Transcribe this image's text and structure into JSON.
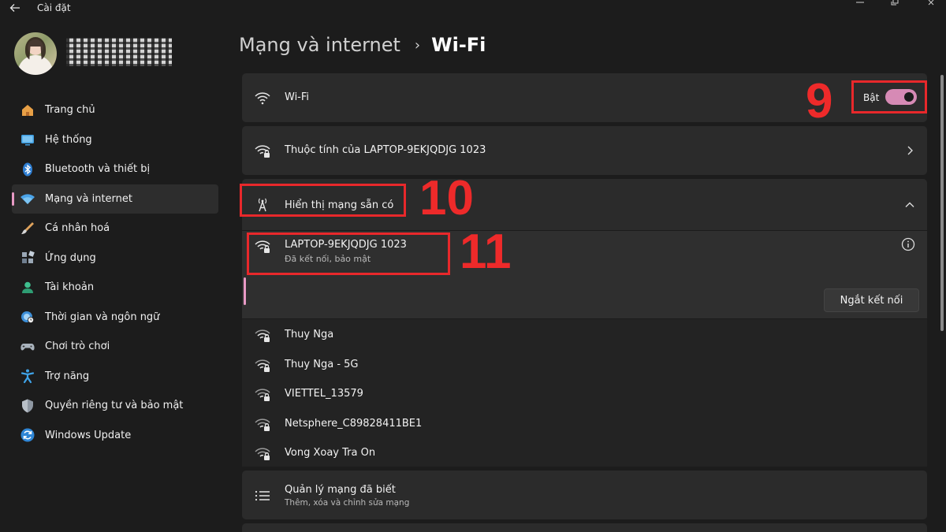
{
  "window": {
    "title": "Cài đặt"
  },
  "sidebar": {
    "items": [
      {
        "label": "Trang chủ",
        "icon": "home-icon",
        "active": false
      },
      {
        "label": "Hệ thống",
        "icon": "monitor-icon",
        "active": false
      },
      {
        "label": "Bluetooth và thiết bị",
        "icon": "bluetooth-icon",
        "active": false
      },
      {
        "label": "Mạng và internet",
        "icon": "wifi-icon",
        "active": true
      },
      {
        "label": "Cá nhân hoá",
        "icon": "brush-icon",
        "active": false
      },
      {
        "label": "Ứng dụng",
        "icon": "apps-icon",
        "active": false
      },
      {
        "label": "Tài khoản",
        "icon": "person-icon",
        "active": false
      },
      {
        "label": "Thời gian và ngôn ngữ",
        "icon": "globe-clock-icon",
        "active": false
      },
      {
        "label": "Chơi trò chơi",
        "icon": "gamepad-icon",
        "active": false
      },
      {
        "label": "Trợ năng",
        "icon": "accessibility-icon",
        "active": false
      },
      {
        "label": "Quyền riêng tư và bảo mật",
        "icon": "shield-icon",
        "active": false
      },
      {
        "label": "Windows Update",
        "icon": "update-icon",
        "active": false
      }
    ]
  },
  "header": {
    "parent": "Mạng và internet",
    "separator": "›",
    "current": "Wi-Fi"
  },
  "wifi": {
    "label": "Wi-Fi",
    "toggle_label": "Bật",
    "toggle_on": true
  },
  "properties": {
    "label": "Thuộc tính của LAPTOP-9EKJQDJG 1023"
  },
  "available": {
    "label": "Hiển thị mạng sẵn có"
  },
  "connected": {
    "name": "LAPTOP-9EKJQDJG 1023",
    "status": "Đã kết nối, bảo mật",
    "disconnect_label": "Ngắt kết nối"
  },
  "networks": [
    {
      "name": "Thuy Nga"
    },
    {
      "name": "Thuy Nga - 5G"
    },
    {
      "name": "VIETTEL_13579"
    },
    {
      "name": "Netsphere_C89828411BE1"
    },
    {
      "name": "Vong Xoay Tra On"
    }
  ],
  "known_networks": {
    "label": "Quản lý mạng đã biết",
    "sublabel": "Thêm, xóa và chỉnh sửa mạng"
  },
  "annotations": {
    "toggle": "9",
    "available": "10",
    "connected": "11",
    "color": "#e8282b"
  },
  "colors": {
    "accent": "#e89ac5",
    "background": "#1c1c1c",
    "card": "#2b2b2b"
  }
}
